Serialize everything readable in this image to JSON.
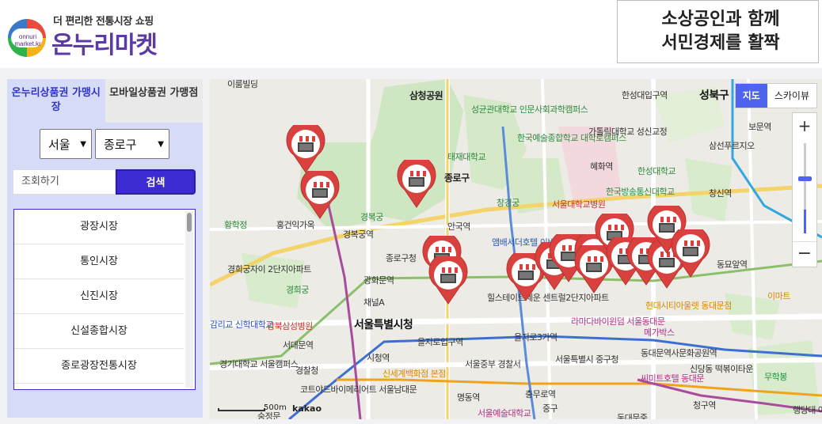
{
  "header": {
    "logo_subtitle": "더 편리한 전통시장 쇼핑",
    "logo_title": "온누리마켓",
    "logo_circle_text": "onnuri market.kr",
    "banner_line1": "소상공인과 함께",
    "banner_line2": "서민경제를 활짝"
  },
  "sidebar": {
    "tabs": [
      {
        "label": "온누리상품권 가맹시장",
        "active": true
      },
      {
        "label": "모바일상품권 가맹점",
        "active": false
      }
    ],
    "region_select": "서울",
    "district_select": "종로구",
    "search": {
      "placeholder": "조회하기",
      "button_label": "검색"
    },
    "markets": [
      "광장시장",
      "통인시장",
      "신진시장",
      "신설종합시장",
      "종로광장전통시장"
    ]
  },
  "map": {
    "type_buttons": {
      "map": "지도",
      "skyview": "스카이뷰"
    },
    "zoom_in": "+",
    "zoom_out": "−",
    "scale_label": "500m",
    "attribution": "kakao",
    "labels": [
      "이룸빌딩",
      "삼청공원",
      "성균관대학교 인문사회과학캠퍼스",
      "한성대입구역",
      "성북구",
      "보문역",
      "한국예술종합학교 대학로캠퍼스",
      "가톨릭대학교 성신교정",
      "삼선푸르지오",
      "태재대학교",
      "혜화역",
      "한성대학교",
      "종로구",
      "창경궁",
      "한국방송통신대학교",
      "창신역",
      "서울대학교병원",
      "경복궁",
      "황학정",
      "홍건익가옥",
      "경복궁역",
      "안국역",
      "앰배서더호텔 이비스",
      "종로구청",
      "동묘앞역",
      "경희궁자이 2단지아파트",
      "광화문역",
      "경희궁",
      "채널A",
      "힐스테이트세운 센트럴2단지아파트",
      "현대시티아울렛 동대문점",
      "이마트",
      "라마다바이윈덤 서울동대문",
      "메가박스",
      "강북삼성병원",
      "서울특별시청",
      "감리교 신학대학교",
      "서대문역",
      "을지로입구역",
      "을지로3가역",
      "서울특별시 중구청",
      "동대문역사문화공원역",
      "시청역",
      "경기대학교 서울캠퍼스",
      "경찰청",
      "신세계백화점 본점",
      "서울중부 경찰서",
      "씨미트호텔 동대문",
      "신당동 떡볶이타운",
      "무학봉",
      "코트야드바이메리어트 서울남대문",
      "명동역",
      "충무로역",
      "중구",
      "서울예술대학교",
      "동대문중",
      "청구역",
      "행당대 아파트",
      "숭정문"
    ]
  },
  "colors": {
    "accent": "#3b2bd0",
    "sidebar_bg": "#d6dbf8",
    "map_button_active": "#4e63f0",
    "marker_red": "#d9413e"
  },
  "icons": [
    "market-marker-icon",
    "subway-station-icon"
  ]
}
